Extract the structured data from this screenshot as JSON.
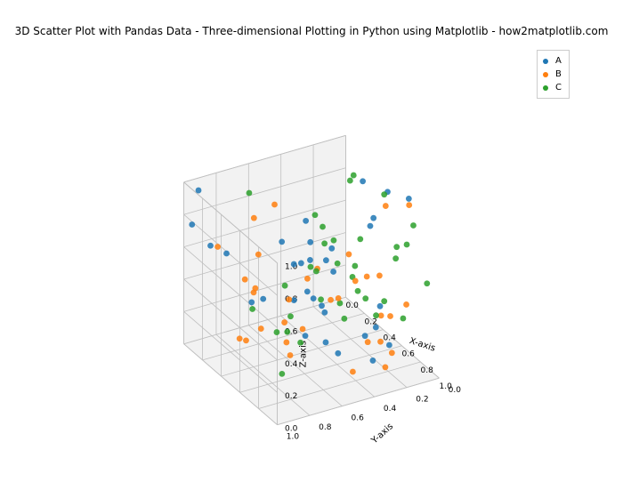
{
  "chart_data": {
    "type": "scatter",
    "title": "3D Scatter Plot with Pandas Data - Three-dimensional Plotting in Python using Matplotlib - how2matplotlib.com",
    "xlabel": "X-axis",
    "ylabel": "Y-axis",
    "zlabel": "Z-axis",
    "xlim": [
      0.0,
      1.0
    ],
    "ylim": [
      0.0,
      1.0
    ],
    "zlim": [
      0.0,
      1.0
    ],
    "xticks": [
      0.0,
      0.2,
      0.4,
      0.6,
      0.8,
      1.0
    ],
    "yticks": [
      0.0,
      0.2,
      0.4,
      0.6,
      0.8,
      1.0
    ],
    "zticks": [
      0.0,
      0.2,
      0.4,
      0.6,
      0.8,
      1.0
    ],
    "legend": [
      "A",
      "B",
      "C"
    ],
    "colors": {
      "A": "#1f77b4",
      "B": "#ff7f0e",
      "C": "#2ca02c"
    },
    "series": [
      {
        "name": "A",
        "points": [
          [
            0.37,
            0.95,
            0.73
          ],
          [
            0.6,
            0.16,
            0.16
          ],
          [
            0.06,
            0.87,
            0.6
          ],
          [
            0.71,
            0.02,
            0.97
          ],
          [
            0.83,
            0.21,
            0.18
          ],
          [
            0.18,
            0.18,
            0.3
          ],
          [
            0.52,
            0.43,
            0.29
          ],
          [
            0.61,
            0.14,
            0.29
          ],
          [
            0.37,
            0.46,
            0.79
          ],
          [
            0.2,
            0.51,
            0.59
          ],
          [
            0.05,
            0.61,
            0.17
          ],
          [
            0.07,
            0.95,
            0.97
          ],
          [
            0.81,
            0.3,
            0.1
          ],
          [
            0.68,
            0.44,
            0.12
          ],
          [
            0.5,
            0.03,
            0.91
          ],
          [
            0.26,
            0.66,
            0.31
          ],
          [
            0.52,
            0.55,
            0.18
          ],
          [
            0.97,
            0.78,
            0.94
          ],
          [
            0.89,
            0.6,
            0.92
          ],
          [
            0.09,
            0.2,
            0.05
          ],
          [
            0.33,
            0.39,
            0.27
          ],
          [
            0.83,
            0.36,
            0.28
          ],
          [
            0.54,
            0.14,
            0.8
          ],
          [
            0.07,
            0.99,
            0.77
          ],
          [
            0.2,
            0.01,
            0.82
          ],
          [
            0.71,
            0.73,
            0.77
          ],
          [
            0.07,
            0.36,
            0.12
          ],
          [
            0.86,
            0.62,
            0.33
          ],
          [
            0.06,
            0.31,
            0.33
          ],
          [
            0.73,
            0.64,
            0.89
          ],
          [
            0.47,
            0.12,
            0.71
          ],
          [
            0.76,
            0.56,
            0.77
          ],
          [
            0.49,
            0.52,
            0.43
          ]
        ]
      },
      {
        "name": "B",
        "points": [
          [
            0.03,
            0.11,
            0.03
          ],
          [
            0.64,
            0.31,
            0.51
          ],
          [
            0.91,
            0.25,
            0.41
          ],
          [
            0.76,
            0.23,
            0.58
          ],
          [
            0.12,
            0.05,
            0.34
          ],
          [
            0.91,
            0.24,
            0.18
          ],
          [
            0.04,
            0.59,
            0.68
          ],
          [
            0.67,
            0.14,
            0.94
          ],
          [
            0.18,
            0.37,
            0.0
          ],
          [
            0.25,
            0.8,
            0.1
          ],
          [
            0.02,
            0.57,
            0.23
          ],
          [
            0.33,
            0.63,
            0.92
          ],
          [
            0.44,
            0.62,
            0.12
          ],
          [
            0.32,
            0.36,
            0.44
          ],
          [
            0.73,
            0.99,
            0.68
          ],
          [
            0.79,
            0.32,
            0.21
          ],
          [
            0.93,
            0.88,
            0.36
          ],
          [
            0.28,
            0.54,
            0.14
          ],
          [
            0.8,
            0.07,
            0.99
          ],
          [
            0.77,
            0.2,
            0.01
          ],
          [
            0.82,
            0.71,
            0.73
          ],
          [
            0.77,
            0.07,
            0.36
          ],
          [
            0.12,
            0.86,
            0.62
          ],
          [
            0.33,
            0.06,
            0.31
          ],
          [
            0.33,
            0.73,
            0.64
          ],
          [
            0.89,
            0.47,
            0.12
          ],
          [
            0.71,
            0.76,
            0.56
          ],
          [
            0.77,
            0.49,
            0.52
          ],
          [
            0.43,
            0.03,
            0.11
          ],
          [
            0.03,
            0.64,
            0.31
          ],
          [
            0.51,
            0.91,
            0.25
          ],
          [
            0.41,
            0.76,
            0.23
          ],
          [
            0.58,
            0.12,
            0.05
          ]
        ]
      },
      {
        "name": "C",
        "points": [
          [
            0.93,
            0.69,
            0.65
          ],
          [
            0.75,
            0.65,
            0.75
          ],
          [
            0.96,
            0.93,
            0.82
          ],
          [
            0.57,
            0.02,
            0.53
          ],
          [
            0.24,
            0.09,
            0.9
          ],
          [
            0.57,
            0.46,
            0.75
          ],
          [
            0.74,
            0.05,
            0.71
          ],
          [
            0.84,
            0.17,
            0.78
          ],
          [
            0.29,
            0.31,
            0.67
          ],
          [
            0.11,
            0.66,
            0.89
          ],
          [
            0.7,
            0.44,
            0.44
          ],
          [
            0.77,
            0.09,
            0.28
          ],
          [
            0.88,
            0.09,
            0.91
          ],
          [
            0.32,
            0.11,
            0.23
          ],
          [
            0.43,
            0.43,
            0.5
          ],
          [
            0.62,
            0.12,
            0.98
          ],
          [
            0.07,
            0.23,
            0.61
          ],
          [
            0.01,
            0.08,
            0.38
          ],
          [
            0.87,
            0.0,
            0.52
          ],
          [
            0.22,
            0.1,
            0.86
          ],
          [
            0.97,
            0.47,
            0.98
          ],
          [
            0.6,
            0.74,
            0.04
          ],
          [
            0.28,
            0.12,
            0.3
          ],
          [
            0.12,
            0.41,
            0.06
          ],
          [
            0.68,
            0.27,
            0.41
          ],
          [
            0.57,
            0.69,
            0.27
          ],
          [
            0.74,
            0.37,
            0.67
          ],
          [
            0.21,
            0.13,
            0.01
          ],
          [
            0.55,
            0.13,
            0.2
          ],
          [
            0.37,
            0.79,
            0.34
          ],
          [
            0.33,
            0.47,
            0.02
          ],
          [
            0.31,
            0.23,
            0.43
          ],
          [
            0.89,
            0.94,
            0.5
          ],
          [
            0.62,
            0.12,
            0.32
          ]
        ]
      }
    ]
  }
}
